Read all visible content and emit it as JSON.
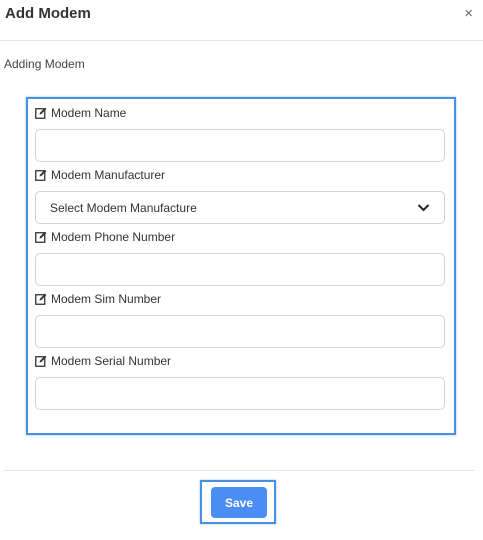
{
  "modal": {
    "title": "Add Modem",
    "close_glyph": "×",
    "subtitle": "Adding Modem"
  },
  "form": {
    "modem_name": {
      "label": "Modem Name",
      "value": "",
      "icon": "edit-icon"
    },
    "modem_manufacturer": {
      "label": "Modem Manufacturer",
      "selected": "Select Modem Manufacture",
      "icon": "edit-icon"
    },
    "modem_phone_number": {
      "label": "Modem Phone Number",
      "value": "",
      "icon": "edit-icon"
    },
    "modem_sim_number": {
      "label": "Modem Sim Number",
      "value": "",
      "icon": "edit-icon"
    },
    "modem_serial_number": {
      "label": "Modem Serial Number",
      "value": "",
      "icon": "edit-icon"
    }
  },
  "footer": {
    "save_label": "Save"
  },
  "colors": {
    "accent": "#4a8ef5",
    "highlight_border": "#4a90e2"
  }
}
